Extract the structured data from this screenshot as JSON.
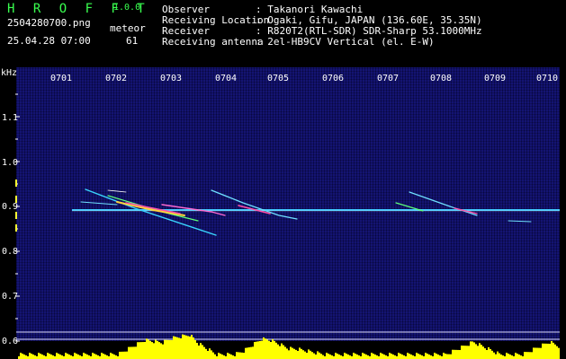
{
  "header": {
    "app_title": "H R O F F T",
    "version": "1.0.0",
    "filename": "2504280700.png",
    "datetime": "25.04.28 07:00",
    "meteor_label": "meteor",
    "meteor_count": "61"
  },
  "info": [
    {
      "key": "Observer",
      "value": ": Takanori Kawachi"
    },
    {
      "key": "Receiving Location",
      "value": ": Ogaki, Gifu, JAPAN (136.60E, 35.35N)"
    },
    {
      "key": "Receiver",
      "value": ": R820T2(RTL-SDR) SDR-Sharp 53.1000MHz"
    },
    {
      "key": "Receiving antenna",
      "value": ": 2el-HB9CV Vertical (el. E-W)"
    }
  ],
  "spectrogram": {
    "y_unit": "kHz",
    "y_ticks": [
      "1.1",
      "1.0",
      "0.9",
      "0.8",
      "0.7",
      "0.6"
    ],
    "x_ticks": [
      "0701",
      "0702",
      "0703",
      "0704",
      "0705",
      "0706",
      "0707",
      "0708",
      "0709",
      "0710"
    ],
    "carrier_khz": 0.893
  },
  "colors": {
    "header_green": "#39ff4f",
    "background": "#0b0a5a",
    "activity_bar": "#ffff00",
    "carrier_line": "#40c8ff"
  }
}
